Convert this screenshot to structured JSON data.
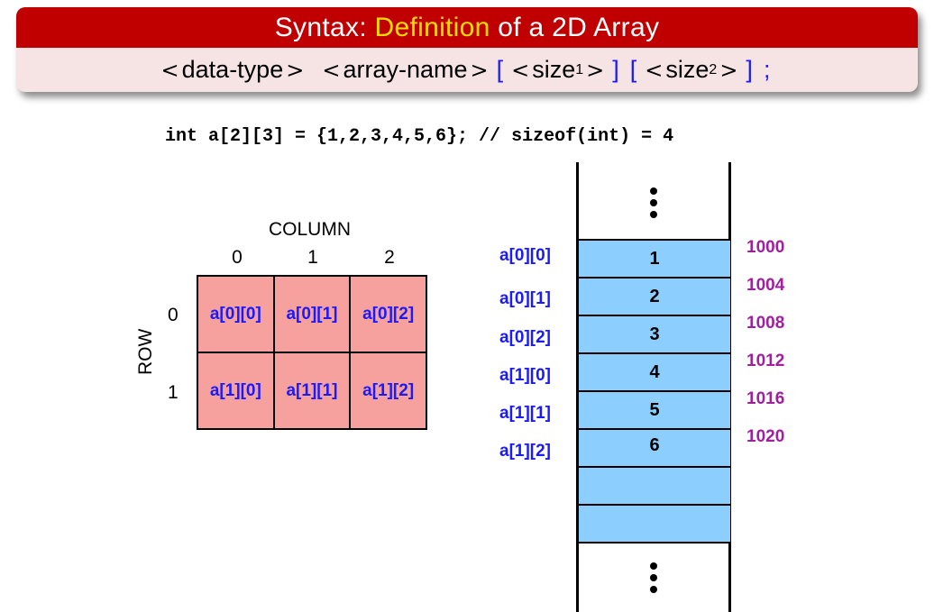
{
  "block": {
    "title_prefix": "Syntax:",
    "title_highlight": "Definition",
    "title_suffix": "of a 2D Array",
    "lt": "<",
    "gt": ">",
    "data_type": "data-type",
    "array_name": "array-name",
    "size_word": "size",
    "sub1": "1",
    "sub2": "2",
    "open_bracket": "[",
    "close_bracket": "]",
    "semicolon": ";"
  },
  "code_line": "int a[2][3] = {1,2,3,4,5,6}; // sizeof(int) = 4",
  "grid": {
    "column_label": "COLUMN",
    "row_label": "ROW",
    "column_indices": [
      "0",
      "1",
      "2"
    ],
    "row_indices": [
      "0",
      "1"
    ],
    "cells": [
      "a[0][0]",
      "a[0][1]",
      "a[0][2]",
      "a[1][0]",
      "a[1][1]",
      "a[1][2]"
    ]
  },
  "memory": {
    "names": [
      "a[0][0]",
      "a[0][1]",
      "a[0][2]",
      "a[1][0]",
      "a[1][1]",
      "a[1][2]"
    ],
    "values": [
      "1",
      "2",
      "3",
      "4",
      "5",
      "6",
      "",
      ""
    ],
    "addresses": [
      "1000",
      "1004",
      "1008",
      "1012",
      "1016",
      "1020"
    ]
  },
  "colors": {
    "title_bg": "#c00000",
    "highlight": "#ffdd00",
    "body_bg": "#f6e4e4",
    "bracket_blue": "#1a1aff",
    "grid_cell": "#f6a19d",
    "memory_cell": "#8ccfff",
    "address_purple": "#a020a0"
  }
}
